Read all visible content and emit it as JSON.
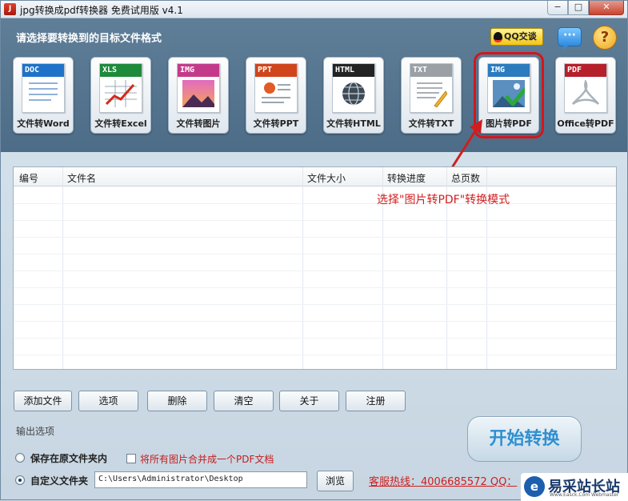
{
  "window": {
    "title": "jpg转换成pdf转换器 免费试用版 v4.1",
    "buttons": [
      "−",
      "□",
      "✕"
    ]
  },
  "top_panel": {
    "heading": "请选择要转换到的目标文件格式",
    "qq_badge": "QQ交谈",
    "help": "?",
    "formats": [
      {
        "tag": "DOC",
        "label": "文件转Word",
        "tag_color": "#1e73c9"
      },
      {
        "tag": "XLS",
        "label": "文件转Excel",
        "tag_color": "#1e8a3a"
      },
      {
        "tag": "IMG",
        "label": "文件转图片",
        "tag_color": "#c43a8a"
      },
      {
        "tag": "PPT",
        "label": "文件转PPT",
        "tag_color": "#d0451b"
      },
      {
        "tag": "HTML",
        "label": "文件转HTML",
        "tag_color": "#222222"
      },
      {
        "tag": "TXT",
        "label": "文件转TXT",
        "tag_color": "#9aa0a6"
      },
      {
        "tag": "IMG",
        "label": "图片转PDF",
        "tag_color": "#2b7bbf",
        "selected": true
      },
      {
        "tag": "PDF",
        "label": "Office转PDF",
        "tag_color": "#b5202a"
      }
    ]
  },
  "annotation": "选择\"图片转PDF\"转换模式",
  "table": {
    "columns": [
      "编号",
      "文件名",
      "文件大小",
      "转换进度",
      "总页数"
    ],
    "rows": []
  },
  "actions": [
    "添加文件",
    "选项",
    "删除",
    "清空",
    "关于",
    "注册"
  ],
  "output": {
    "title": "输出选项",
    "keep_original": "保存在原文件夹内",
    "merge_label": "将所有图片合并成一个PDF文档",
    "custom_folder": "自定义文件夹",
    "path": "C:\\Users\\Administrator\\Desktop",
    "browse": "浏览"
  },
  "start_button": "开始转换",
  "hotline": "客服热线：4006685572 QQ：",
  "watermark": {
    "logo": "e",
    "name": "易采站长站",
    "sub": "Www.Easck.Com Webmaster"
  }
}
